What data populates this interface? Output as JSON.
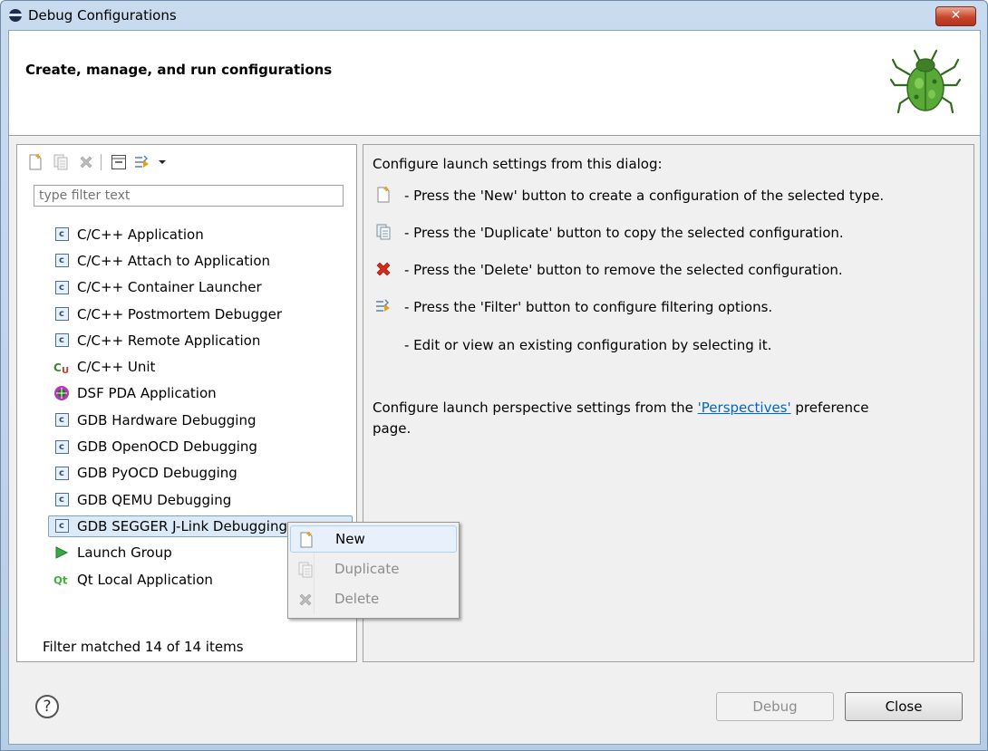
{
  "window": {
    "title": "Debug Configurations",
    "close_label": "✕"
  },
  "header": {
    "title": "Create, manage, and run configurations",
    "icon": "bug-icon"
  },
  "left": {
    "toolbar_icons": [
      "new-config-icon",
      "duplicate-icon",
      "delete-icon",
      "collapse-all-icon",
      "filter-icon",
      "dropdown-arrow-icon"
    ],
    "filter_placeholder": "type filter text",
    "items": [
      {
        "label": "C/C++ Application",
        "icon": "c-app-icon"
      },
      {
        "label": "C/C++ Attach to Application",
        "icon": "c-app-icon"
      },
      {
        "label": "C/C++ Container Launcher",
        "icon": "c-app-icon"
      },
      {
        "label": "C/C++ Postmortem Debugger",
        "icon": "c-app-icon"
      },
      {
        "label": "C/C++ Remote Application",
        "icon": "c-app-icon"
      },
      {
        "label": "C/C++ Unit",
        "icon": "c-unit-icon"
      },
      {
        "label": "DSF PDA Application",
        "icon": "pda-icon"
      },
      {
        "label": "GDB Hardware Debugging",
        "icon": "c-app-icon"
      },
      {
        "label": "GDB OpenOCD Debugging",
        "icon": "c-app-icon"
      },
      {
        "label": "GDB PyOCD Debugging",
        "icon": "c-app-icon"
      },
      {
        "label": "GDB QEMU Debugging",
        "icon": "c-app-icon"
      },
      {
        "label": "GDB SEGGER J-Link Debugging",
        "icon": "c-app-icon",
        "selected": true
      },
      {
        "label": "Launch Group",
        "icon": "launch-group-icon"
      },
      {
        "label": "Qt Local Application",
        "icon": "qt-icon"
      }
    ],
    "status": "Filter matched 14 of 14 items"
  },
  "right": {
    "intro": "Configure launch settings from this dialog:",
    "lines": [
      {
        "icon": "new-config-icon",
        "text": "- Press the 'New' button to create a configuration of the selected type."
      },
      {
        "icon": "duplicate-icon",
        "text": "- Press the 'Duplicate' button to copy the selected configuration."
      },
      {
        "icon": "delete-icon",
        "text": "- Press the 'Delete' button to remove the selected configuration."
      },
      {
        "icon": "filter-icon",
        "text": "- Press the 'Filter' button to configure filtering options."
      },
      {
        "icon": "",
        "text": "- Edit or view an existing configuration by selecting it."
      }
    ],
    "perspective_prefix": "Configure launch perspective settings from the ",
    "perspective_link": "'Perspectives'",
    "perspective_suffix": " preference",
    "perspective_line2": "page."
  },
  "context_menu": {
    "items": [
      {
        "label": "New",
        "icon": "new-config-icon",
        "enabled": true
      },
      {
        "label": "Duplicate",
        "icon": "duplicate-icon",
        "enabled": false
      },
      {
        "label": "Delete",
        "icon": "delete-icon",
        "enabled": false
      }
    ]
  },
  "footer": {
    "help_label": "?",
    "debug_label": "Debug",
    "close_label": "Close"
  },
  "colors": {
    "title_gradient": "#c9dbef",
    "selection": "#dce9f7",
    "link": "#0066cc",
    "delete_red": "#d9281a"
  }
}
